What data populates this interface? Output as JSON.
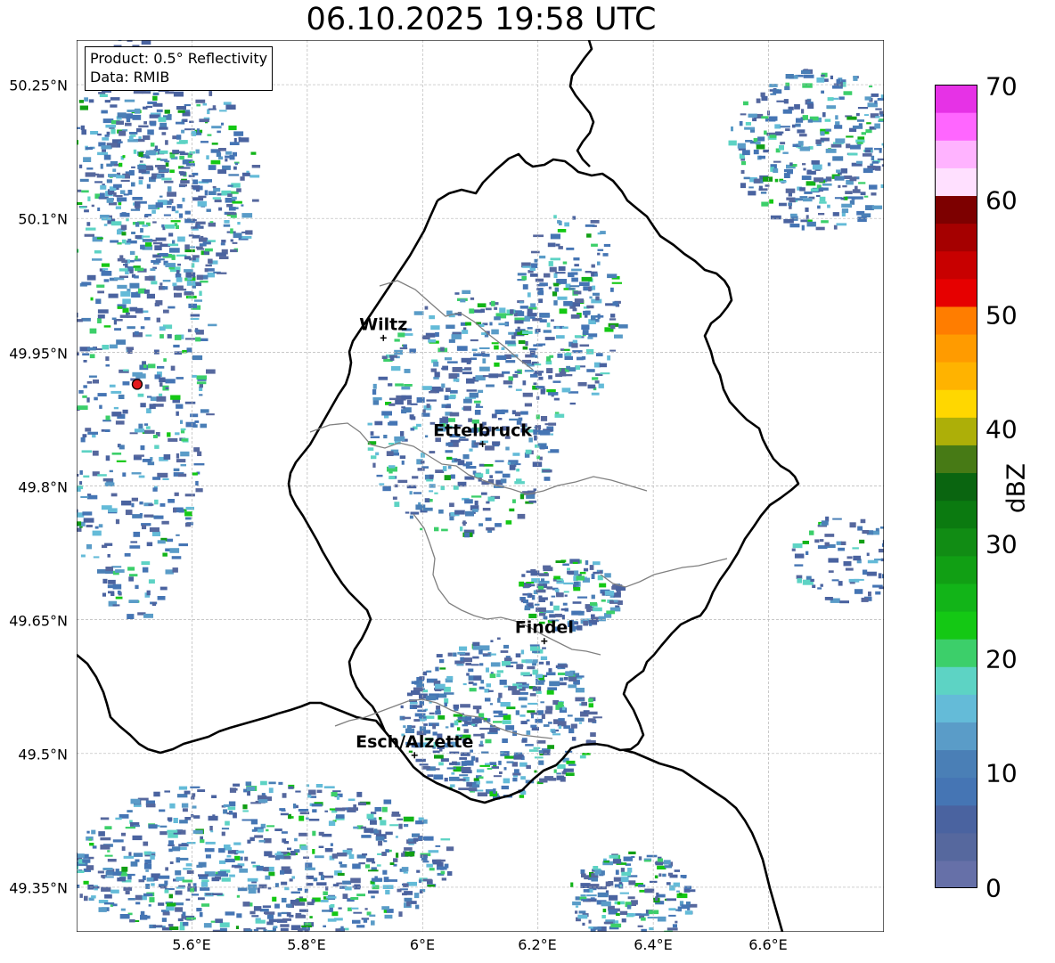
{
  "title": "06.10.2025 19:58 UTC",
  "info": {
    "product": "Product: 0.5° Reflectivity",
    "source": "Data: RMIB"
  },
  "map": {
    "lon_range": [
      5.4,
      6.8
    ],
    "lat_range": [
      49.3,
      50.3
    ],
    "lat_ticks": [
      "50.25°N",
      "50.1°N",
      "49.95°N",
      "49.8°N",
      "49.65°N",
      "49.5°N",
      "49.35°N"
    ],
    "lon_ticks": [
      "5.6°E",
      "5.8°E",
      "6°E",
      "6.2°E",
      "6.4°E",
      "6.6°E"
    ],
    "gridlines": true,
    "radar_site": {
      "lon": 5.505,
      "lat": 49.914
    },
    "cities": [
      {
        "name": "Wiltz",
        "lon": 5.932,
        "lat": 49.966
      },
      {
        "name": "Ettelbruck",
        "lon": 6.104,
        "lat": 49.847
      },
      {
        "name": "Findel",
        "lon": 6.211,
        "lat": 49.626
      },
      {
        "name": "Esch/Alzette",
        "lon": 5.986,
        "lat": 49.498
      }
    ]
  },
  "colorbar": {
    "label": "dBZ",
    "min": 0,
    "max": 70,
    "ticks": [
      "0",
      "10",
      "20",
      "30",
      "40",
      "50",
      "60",
      "70"
    ],
    "colors": [
      "#6670a8",
      "#56689e",
      "#4a63a0",
      "#4575b4",
      "#4a7fb6",
      "#5a9cc8",
      "#64bbd8",
      "#5dd3c4",
      "#3ccf6a",
      "#14c814",
      "#12b418",
      "#119f14",
      "#118c14",
      "#0b7a10",
      "#0a6510",
      "#477a15",
      "#adaf08",
      "#ffd700",
      "#ffb300",
      "#ff9b00",
      "#ff7d00",
      "#e60000",
      "#c80000",
      "#a50000",
      "#7d0000",
      "#ffe0ff",
      "#ffb3ff",
      "#ff66ff",
      "#e632e6"
    ]
  }
}
